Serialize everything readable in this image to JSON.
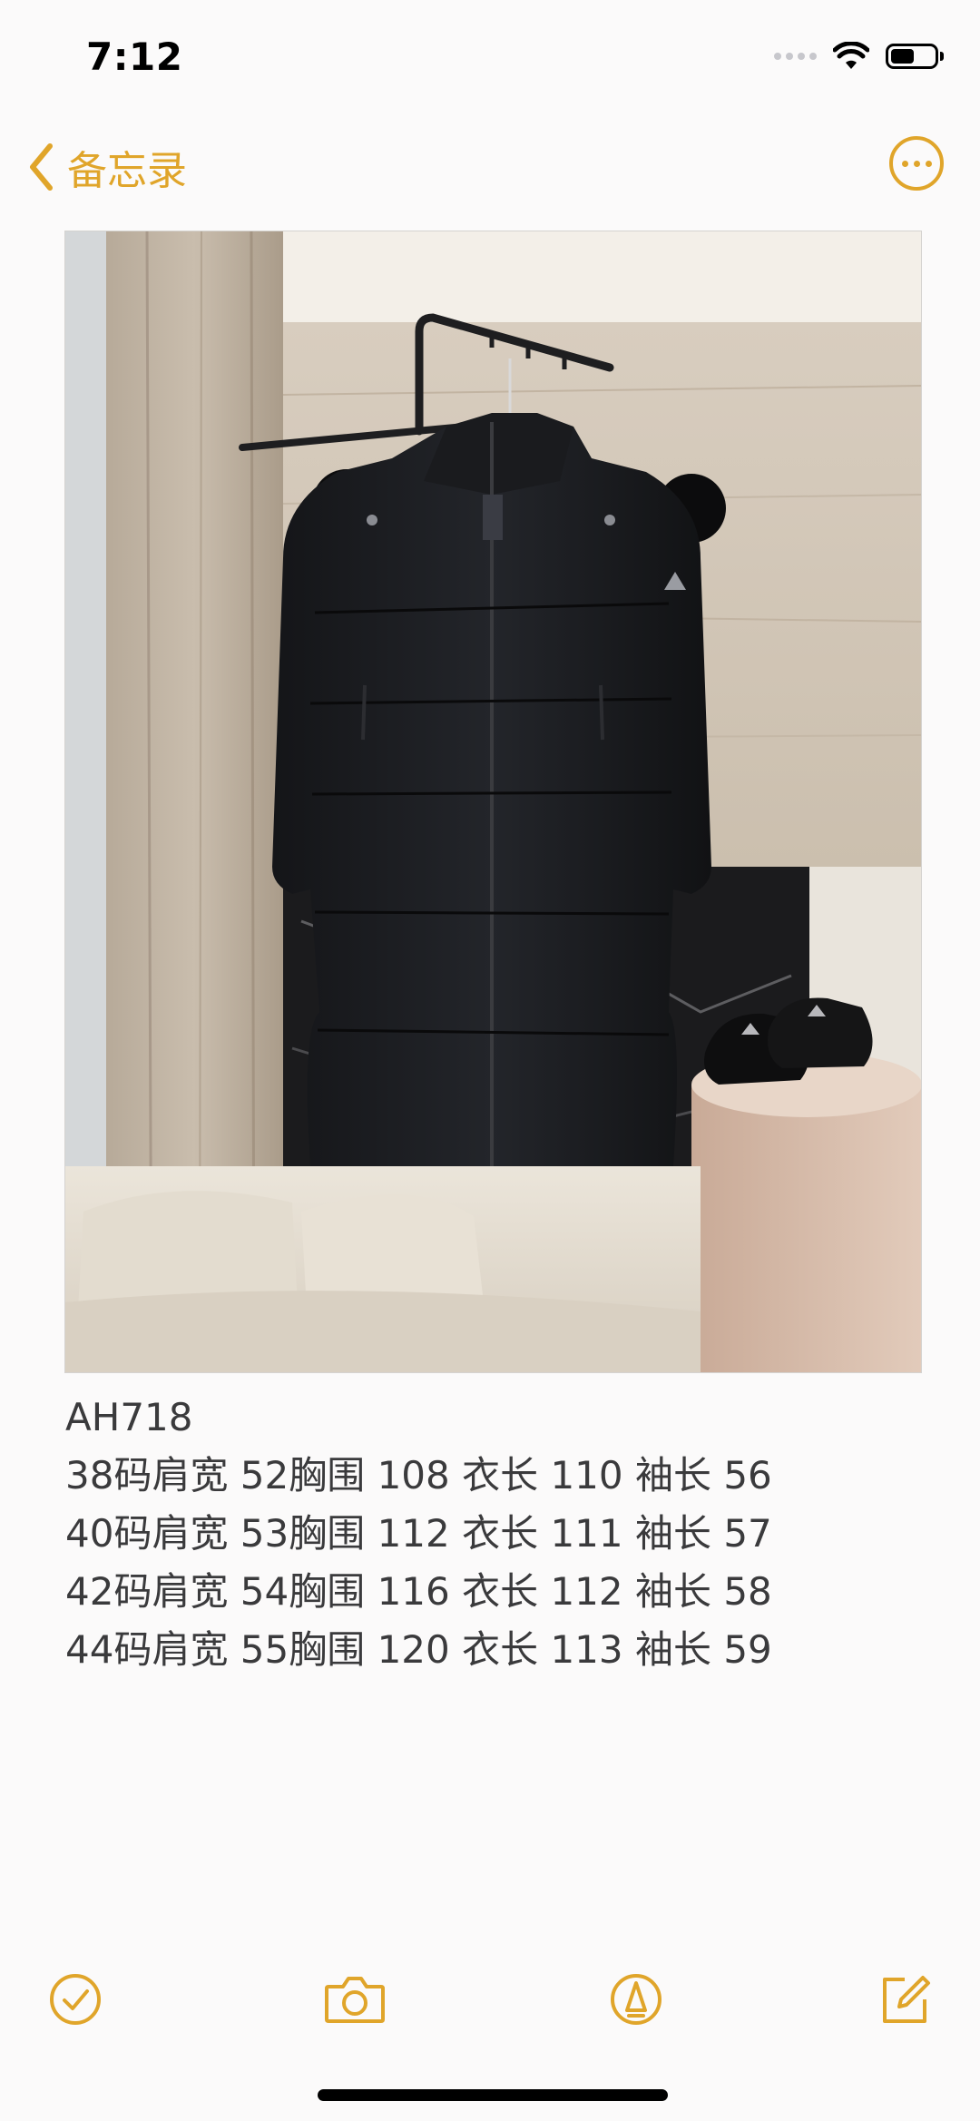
{
  "status_bar": {
    "time": "7:12",
    "icons": [
      "signal-dots",
      "wifi-icon",
      "battery-icon"
    ]
  },
  "nav": {
    "back_label": "备忘录",
    "accent_color": "#e0a52a",
    "back_icon": "chevron-left-icon",
    "more_icon": "ellipsis-circle-icon"
  },
  "note": {
    "photo_subject": "black-long-down-jacket-photo",
    "lines": [
      "AH718",
      "38码肩宽 52胸围 108 衣长 110 袖长 56",
      "40码肩宽 53胸围 112 衣长 111 袖长 57",
      "42码肩宽 54胸围 116 衣长 112 袖长 58",
      "44码肩宽 55胸围 120 衣长 113 袖长 59"
    ]
  },
  "toolbar": {
    "icons": [
      "checklist-icon",
      "camera-icon",
      "markup-pen-icon",
      "compose-icon"
    ]
  }
}
